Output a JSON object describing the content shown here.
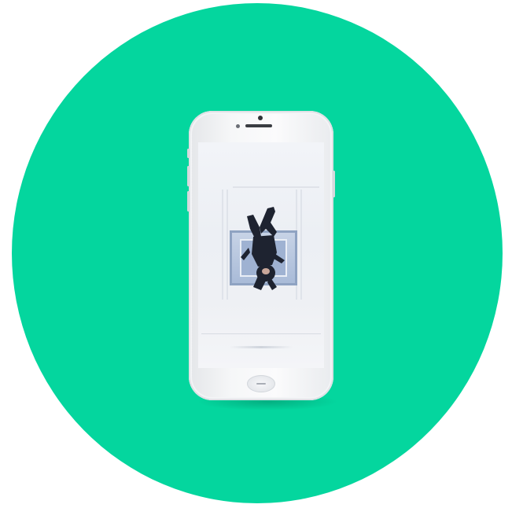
{
  "colors": {
    "background": "#ffffff",
    "circle": "#04d69e",
    "phone_body": "#f4f5f7",
    "screen": "#eef0f4",
    "figure": "#1f2430"
  },
  "icons": {
    "device": "smartphone-icon",
    "home_button": "home-button-icon",
    "camera": "front-camera-icon"
  },
  "screen_content": {
    "image": "person-illustration"
  }
}
